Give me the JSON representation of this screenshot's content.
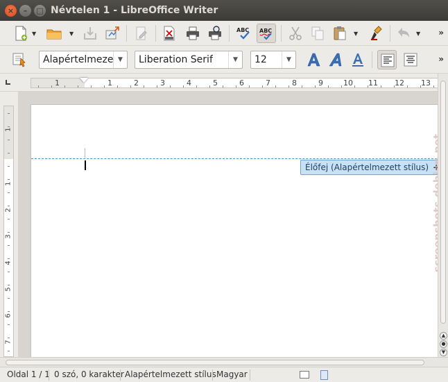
{
  "window": {
    "title": "Névtelen 1 - LibreOffice Writer",
    "close_symbol": "×",
    "minimize_symbol": "–",
    "maximize_symbol": "□"
  },
  "toolbar_standard": {
    "icons": [
      "new-document-icon",
      "open-folder-icon",
      "save-icon",
      "export-icon",
      "edit-file-icon",
      "export-pdf-icon",
      "print-icon",
      "print-preview-icon",
      "spellcheck-icon",
      "autospellcheck-icon",
      "cut-icon",
      "copy-icon",
      "paste-icon",
      "clone-formatting-icon",
      "undo-icon"
    ],
    "more_symbol": "»"
  },
  "toolbar_formatting": {
    "paragraph_style": "Alapértelmeze",
    "font_name": "Liberation Serif",
    "font_size": "12",
    "icons": [
      "styles-icon",
      "bold-icon",
      "italic-icon",
      "underline-icon",
      "align-left-icon",
      "align-center-icon"
    ],
    "more_symbol": "»"
  },
  "ruler": {
    "labels": [
      "1",
      "1",
      "2",
      "3",
      "4",
      "5",
      "6",
      "7",
      "8",
      "9",
      "10",
      "11",
      "12",
      "13"
    ]
  },
  "vertical_ruler": {
    "labels": [
      "1",
      "1",
      "2",
      "3",
      "4",
      "5",
      "6",
      "7"
    ]
  },
  "document": {
    "header_tag": "Élőfej (Alapértelmezett stílus)",
    "header_tag_plus": "+"
  },
  "statusbar": {
    "page": "Oldal 1 / 1",
    "words": "0 szó, 0 karakter",
    "page_style": "Alapértelmezett stílus",
    "language": "Magyar"
  },
  "watermark": {
    "text": "screenshots.debian.net"
  },
  "colors": {
    "titlebar": "#3c3b37",
    "close_button": "#dd4814",
    "header_tag_bg": "#c9e1f5",
    "header_line": "#4a8fbf"
  }
}
